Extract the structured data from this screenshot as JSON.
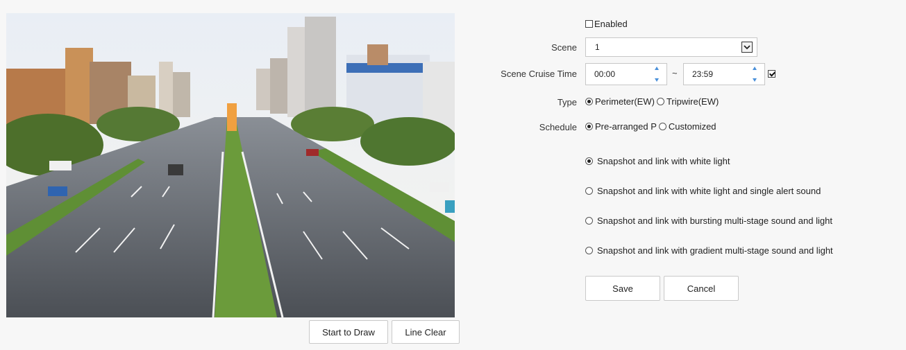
{
  "video": {
    "buttons": {
      "start_draw": "Start to Draw",
      "line_clear": "Line Clear"
    }
  },
  "form": {
    "enabled": {
      "label": "Enabled",
      "checked": false
    },
    "scene": {
      "label": "Scene",
      "value": "1"
    },
    "cruise_time": {
      "label": "Scene Cruise Time",
      "start": "00:00",
      "separator": "~",
      "end": "23:59",
      "checked": true
    },
    "type": {
      "label": "Type",
      "options": [
        "Perimeter(EW)",
        "Tripwire(EW)"
      ],
      "selected": "Perimeter(EW)"
    },
    "schedule": {
      "label": "Schedule",
      "options": [
        "Pre-arranged P",
        "Customized"
      ],
      "selected": "Pre-arranged P"
    },
    "linkage_options": [
      "Snapshot and link with white light",
      "Snapshot and link with white light and single alert sound",
      "Snapshot and link with bursting multi-stage sound and light",
      "Snapshot and link with gradient multi-stage sound and light"
    ],
    "linkage_selected": "Snapshot and link with white light",
    "buttons": {
      "save": "Save",
      "cancel": "Cancel"
    }
  },
  "colors": {
    "radio_dot": "#222222",
    "spinner_arrow": "#4a90d9",
    "button_border": "#c9c9c9"
  }
}
